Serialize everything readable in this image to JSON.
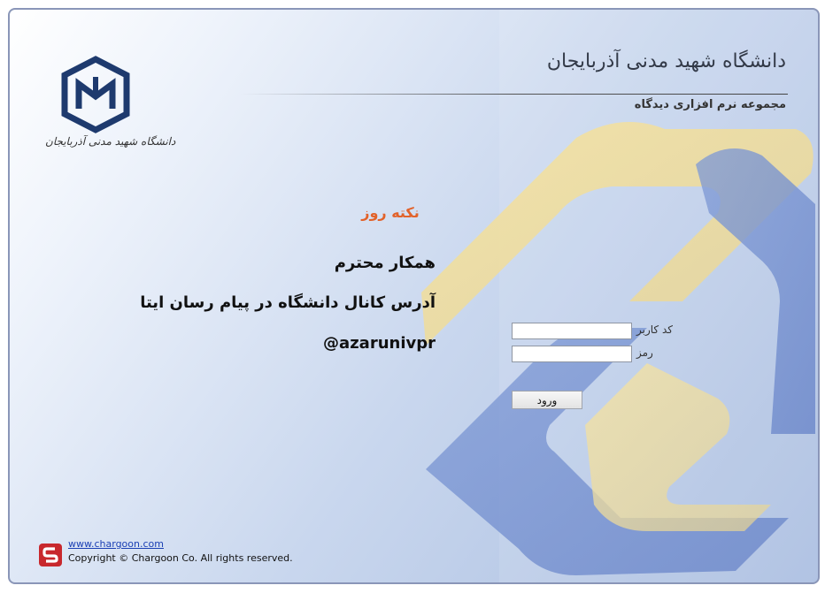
{
  "header": {
    "university_name": "دانشگاه شهید مدنی آذربایجان",
    "system_name": "مجموعه نرم افزاری دیدگاه",
    "logo_caption": "دانشگاه شهید مدنی آذربایجان"
  },
  "tip": {
    "title": "نکته روز",
    "lines": [
      "همکار محترم",
      "آدرس کانال دانشگاه در پیام رسان ایتا",
      "@azarunivpr"
    ]
  },
  "login": {
    "username_label": "کد کاربر",
    "password_label": "رمز",
    "username_value": "",
    "password_value": "",
    "submit_label": "ورود"
  },
  "footer": {
    "link": "www.chargoon.com",
    "copyright": "Copyright © Chargoon Co. All rights reserved."
  },
  "colors": {
    "tip_title": "#e2622a",
    "link": "#1a3fb4",
    "logo_blue": "#1e3a6e",
    "footer_logo_red": "#c8282d"
  },
  "icons": {
    "university_logo": "university-logo-icon",
    "footer_logo": "chargoon-logo-icon"
  }
}
